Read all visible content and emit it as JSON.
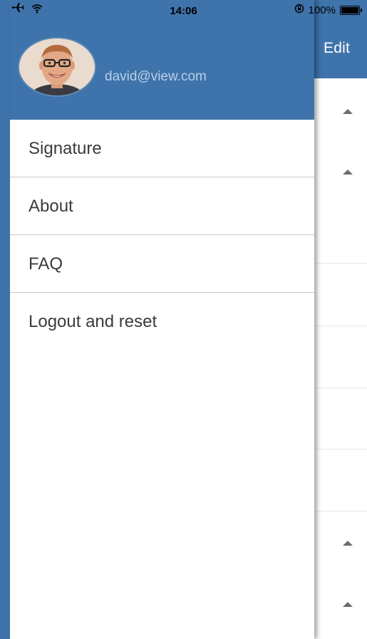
{
  "status_bar": {
    "time": "14:06",
    "battery": "100%",
    "icons": [
      "airplane-mode-icon",
      "wifi-icon",
      "rotation-lock-icon",
      "battery-icon"
    ]
  },
  "background_app": {
    "edit_label": "Edit"
  },
  "drawer": {
    "email": "david@view.com",
    "menu": [
      {
        "label": "Signature"
      },
      {
        "label": "About"
      },
      {
        "label": "FAQ"
      },
      {
        "label": "Logout and reset"
      }
    ]
  },
  "colors": {
    "header_blue": "#3e74ab",
    "email_text": "#b9cfe6",
    "menu_text": "#3b3b3b",
    "divider": "#c8c8c8"
  }
}
